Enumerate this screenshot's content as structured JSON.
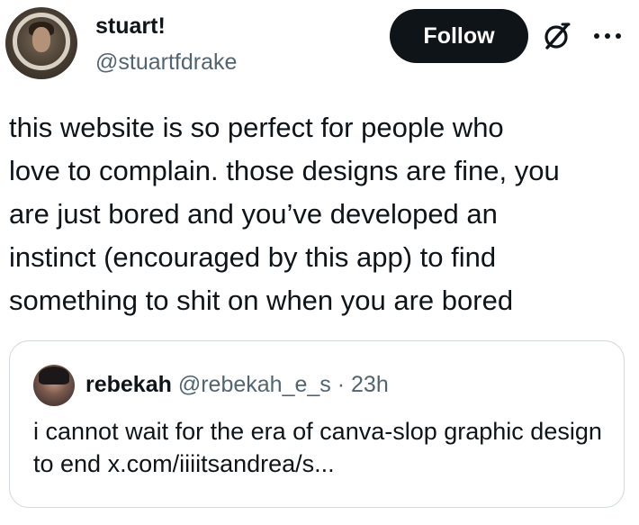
{
  "author": {
    "display_name": "stuart!",
    "handle": "@stuartfdrake"
  },
  "actions": {
    "follow_label": "Follow",
    "grok_icon": "grok-slash-circle-icon",
    "more_icon": "more-horizontal-icon"
  },
  "tweet": {
    "text": "this website is so perfect for people who\nlove to complain. those designs are fine, you\nare just bored and you’ve developed an\ninstinct (encouraged by this app) to find\nsomething to shit on when you are bored"
  },
  "quote": {
    "display_name": "rebekah",
    "handle": "@rebekah_e_s",
    "separator": "·",
    "time": "23h",
    "text": "i cannot wait for the era of canva-slop graphic design to end x.com/iiiitsandrea/s..."
  },
  "colors": {
    "text_primary": "#0f1419",
    "text_secondary": "#536471",
    "follow_bg": "#0f1419",
    "border": "#cfd9de"
  }
}
